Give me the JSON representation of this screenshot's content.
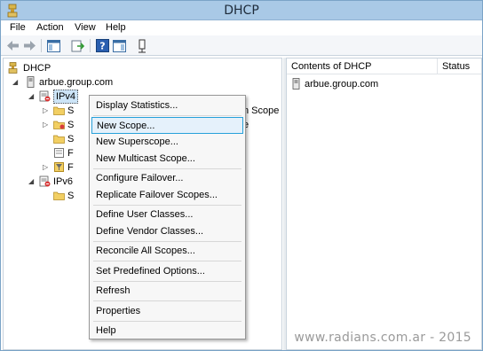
{
  "window": {
    "title": "DHCP"
  },
  "menubar": {
    "items": [
      "File",
      "Action",
      "View",
      "Help"
    ]
  },
  "toolbar": {
    "buttons": [
      "back-arrow-icon",
      "forward-arrow-icon",
      "show-hide-tree-icon",
      "export-list-icon",
      "help-icon",
      "show-hide-action-pane-icon",
      "dhcp-server-icon"
    ]
  },
  "tree": {
    "root": "DHCP",
    "server": "arbue.group.com",
    "ipv4": "IPv4",
    "ipv4_partial_children": [
      "S",
      "S",
      "S",
      "F",
      "F"
    ],
    "obscured_text_1": "n Scope",
    "obscured_text_2": "e",
    "ipv6": "IPv6",
    "ipv6_partial_children": [
      "S"
    ]
  },
  "detail": {
    "columns": [
      "Contents of DHCP",
      "Status"
    ],
    "rows": [
      {
        "name": "arbue.group.com",
        "status": ""
      }
    ]
  },
  "context_menu": {
    "items": [
      {
        "label": "Display Statistics...",
        "highlight": false
      },
      {
        "sep": true
      },
      {
        "label": "New Scope...",
        "highlight": true
      },
      {
        "label": "New Superscope...",
        "highlight": false
      },
      {
        "label": "New Multicast Scope...",
        "highlight": false
      },
      {
        "sep": true
      },
      {
        "label": "Configure Failover...",
        "highlight": false
      },
      {
        "label": "Replicate Failover Scopes...",
        "highlight": false
      },
      {
        "sep": true
      },
      {
        "label": "Define User Classes...",
        "highlight": false
      },
      {
        "label": "Define Vendor Classes...",
        "highlight": false
      },
      {
        "sep": true
      },
      {
        "label": "Reconcile All Scopes...",
        "highlight": false
      },
      {
        "sep": true
      },
      {
        "label": "Set Predefined Options...",
        "highlight": false
      },
      {
        "sep": true
      },
      {
        "label": "Refresh",
        "highlight": false
      },
      {
        "sep": true
      },
      {
        "label": "Properties",
        "highlight": false
      },
      {
        "sep": true
      },
      {
        "label": "Help",
        "highlight": false
      }
    ]
  },
  "watermark": "www.radians.com.ar - 2015",
  "colors": {
    "titlebar": "#a9c9e6",
    "menu_highlight": "#e5f1fb",
    "menu_highlight_border": "#26a0da"
  }
}
